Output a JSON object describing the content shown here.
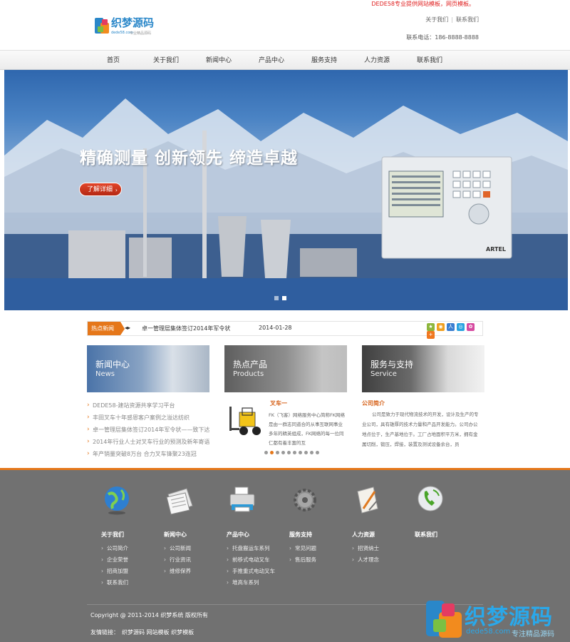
{
  "header": {
    "logo_brand": "织梦源码",
    "logo_domain": "dede58.com",
    "logo_tag": "专业精品源码",
    "promo": "DEDE58专业提供网站模板，网页模板。",
    "links": [
      "关于我们",
      "联系我们"
    ],
    "phone": "联系电话：186-8888-8888"
  },
  "nav": {
    "items": [
      "首页",
      "关于我们",
      "新闻中心",
      "产品中心",
      "服务支持",
      "人力资源",
      "联系我们"
    ]
  },
  "banner": {
    "title": "精确测量  创新领先  缔造卓越",
    "button_label": "了解详细",
    "device_brand": "ARTEL",
    "active_slide": 2,
    "slide_count": 2
  },
  "hotnews": {
    "tab": "热点新闻",
    "title": "卓一管理层集体签订2014年军令状",
    "date": "2014-01-28"
  },
  "columns": {
    "news": {
      "title": "新闻中心",
      "subtitle": "News",
      "items": [
        "DEDE58-建站资源共享学习平台",
        "丰田叉车十年感恩客户案例之溢达纺织",
        "卓一管理层集体签订2014年军令状——致下达",
        "2014年行业人士对叉车行业的预测及新年寄语",
        "年产销量突破8万台 合力叉车锋聚23连冠"
      ]
    },
    "products": {
      "title": "热点产品",
      "subtitle": "Products",
      "item_title": "叉车一",
      "item_desc": "FK（飞客）网络服务中心简称FK网络是由一群志同道合的从事互联网事业多年的精英组成，FK网络的每一位同仁都有着丰富的互",
      "carousel_count": 10,
      "carousel_active": 2
    },
    "service": {
      "title": "服务与支持",
      "subtitle": "Service",
      "item_title": "公司简介",
      "item_desc": "公司是致力于现代物流技术的开发，设计及生产的专业公司，具有雄厚的技术力量和产品开发能力。公司办公地点位于，生产基地位于。工厂占地面积平方米，拥有金属切削，锻压，焊接，装置及测试设备余台，员"
    }
  },
  "footer": {
    "columns": [
      {
        "head": "关于我们",
        "icon": "globe-icon",
        "items": [
          "公司简介",
          "企业荣誉",
          "招商加盟",
          "联系我们"
        ]
      },
      {
        "head": "新闻中心",
        "icon": "newspaper-icon",
        "items": [
          "公司新闻",
          "行业资讯",
          "维修保养"
        ]
      },
      {
        "head": "产品中心",
        "icon": "printer-icon",
        "items": [
          "托盘搬运车系列",
          "前移式电动叉车",
          "手推重式电动叉车",
          "堆高车系列"
        ]
      },
      {
        "head": "服务支持",
        "icon": "gear-icon",
        "items": [
          "常见问题",
          "售后服务"
        ]
      },
      {
        "head": "人力资源",
        "icon": "document-pen-icon",
        "items": [
          "招贤纳士",
          "人才理念"
        ]
      },
      {
        "head": "联系我们",
        "icon": "phone-icon",
        "items": []
      }
    ],
    "copyright": "Copyright @ 2011-2014 织梦系统 版权所有",
    "links_label": "友情链接：",
    "links": [
      "织梦源码",
      "网站模板",
      "织梦模板"
    ]
  },
  "watermark": {
    "brand": "织梦源码",
    "domain": "dede58.com",
    "tag": "专注精品源码"
  },
  "colors": {
    "accent_orange": "#e5771a",
    "banner_blue": "#2f67ae",
    "footer_gray": "#717171",
    "promo_red": "#e02020",
    "brand_blue": "#2aa8ea"
  }
}
